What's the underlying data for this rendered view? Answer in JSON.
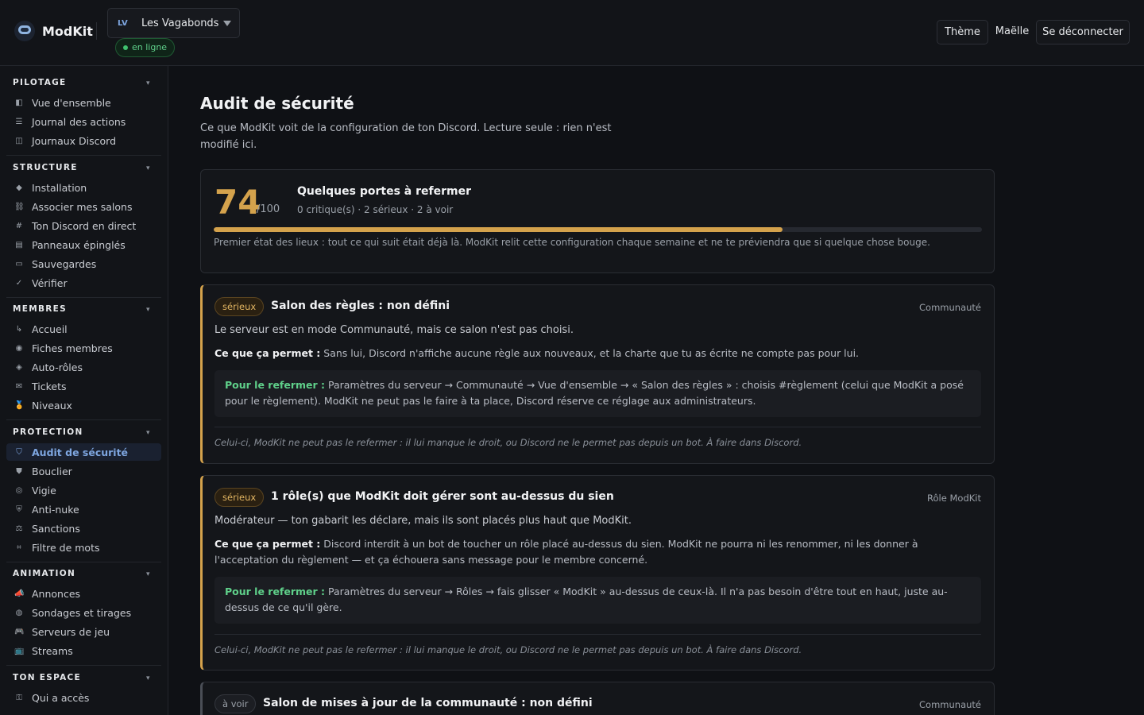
{
  "app": {
    "name": "ModKit"
  },
  "guild": {
    "badge": "LV",
    "name": "Les Vagabonds",
    "status": "en ligne"
  },
  "top_actions": {
    "theme": "Thème",
    "user": "Maëlle",
    "logout": "Se déconnecter"
  },
  "sidebar": {
    "sections": [
      {
        "title": "PILOTAGE",
        "items": [
          {
            "icon": "◧",
            "label": "Vue d'ensemble"
          },
          {
            "icon": "☰",
            "label": "Journal des actions"
          },
          {
            "icon": "◫",
            "label": "Journaux Discord"
          }
        ]
      },
      {
        "title": "STRUCTURE",
        "items": [
          {
            "icon": "◆",
            "label": "Installation"
          },
          {
            "icon": "⛓",
            "label": "Associer mes salons"
          },
          {
            "icon": "#",
            "label": "Ton Discord en direct"
          },
          {
            "icon": "▤",
            "label": "Panneaux épinglés"
          },
          {
            "icon": "▭",
            "label": "Sauvegardes"
          },
          {
            "icon": "✓",
            "label": "Vérifier"
          }
        ]
      },
      {
        "title": "MEMBRES",
        "items": [
          {
            "icon": "↳",
            "label": "Accueil"
          },
          {
            "icon": "◉",
            "label": "Fiches membres"
          },
          {
            "icon": "◈",
            "label": "Auto-rôles"
          },
          {
            "icon": "✉",
            "label": "Tickets"
          },
          {
            "icon": "🏅",
            "label": "Niveaux"
          }
        ]
      },
      {
        "title": "PROTECTION",
        "items": [
          {
            "icon": "⛉",
            "label": "Audit de sécurité",
            "active": true
          },
          {
            "icon": "⛊",
            "label": "Bouclier"
          },
          {
            "icon": "◎",
            "label": "Vigie"
          },
          {
            "icon": "⛨",
            "label": "Anti-nuke"
          },
          {
            "icon": "⚖",
            "label": "Sanctions"
          },
          {
            "icon": "⌗",
            "label": "Filtre de mots"
          }
        ]
      },
      {
        "title": "ANIMATION",
        "items": [
          {
            "icon": "📣",
            "label": "Annonces"
          },
          {
            "icon": "◍",
            "label": "Sondages et tirages"
          },
          {
            "icon": "🎮",
            "label": "Serveurs de jeu"
          },
          {
            "icon": "📺",
            "label": "Streams"
          }
        ]
      },
      {
        "title": "TON ESPACE",
        "items": [
          {
            "icon": "⚿",
            "label": "Qui a accès"
          }
        ]
      }
    ]
  },
  "page": {
    "title": "Audit de sécurité",
    "subtitle": "Ce que ModKit voit de la configuration de ton Discord. Lecture seule : rien n'est modifié ici."
  },
  "score": {
    "value": "74",
    "max": "/100",
    "progress": 0.74,
    "title": "Quelques portes à refermer",
    "summary": "0 critique(s) · 2 sérieux · 2 à voir",
    "note": "Premier état des lieux : tout ce qui suit était déjà là. ModKit relit cette configuration chaque semaine et ne te préviendra que si quelque chose bouge."
  },
  "labels": {
    "impact": "Ce que ça permet :",
    "fix": "Pour le refermer :",
    "manual": "Celui-ci, ModKit ne peut pas le refermer : il lui manque le droit, ou Discord ne le permet pas depuis un bot. À faire dans Discord."
  },
  "issues": [
    {
      "severity": "sérieux",
      "title": "Salon des règles : non défini",
      "category": "Communauté",
      "description": "Le serveur est en mode Communauté, mais ce salon n'est pas choisi.",
      "impact": "Sans lui, Discord n'affiche aucune règle aux nouveaux, et la charte que tu as écrite ne compte pas pour lui.",
      "fix": "Paramètres du serveur → Communauté → Vue d'ensemble → « Salon des règles » : choisis #règlement (celui que ModKit a posé pour le règlement). ModKit ne peut pas le faire à ta place, Discord réserve ce réglage aux administrateurs."
    },
    {
      "severity": "sérieux",
      "title": "1 rôle(s) que ModKit doit gérer sont au-dessus du sien",
      "category": "Rôle ModKit",
      "description": "Modérateur — ton gabarit les déclare, mais ils sont placés plus haut que ModKit.",
      "impact": "Discord interdit à un bot de toucher un rôle placé au-dessus du sien. ModKit ne pourra ni les renommer, ni les donner à l'acceptation du règlement — et ça échouera sans message pour le membre concerné.",
      "fix": "Paramètres du serveur → Rôles → fais glisser « ModKit » au-dessus de ceux-là. Il n'a pas besoin d'être tout en haut, juste au-dessus de ce qu'il gère."
    },
    {
      "severity": "à voir",
      "title": "Salon de mises à jour de la communauté : non défini",
      "category": "Communauté"
    }
  ]
}
